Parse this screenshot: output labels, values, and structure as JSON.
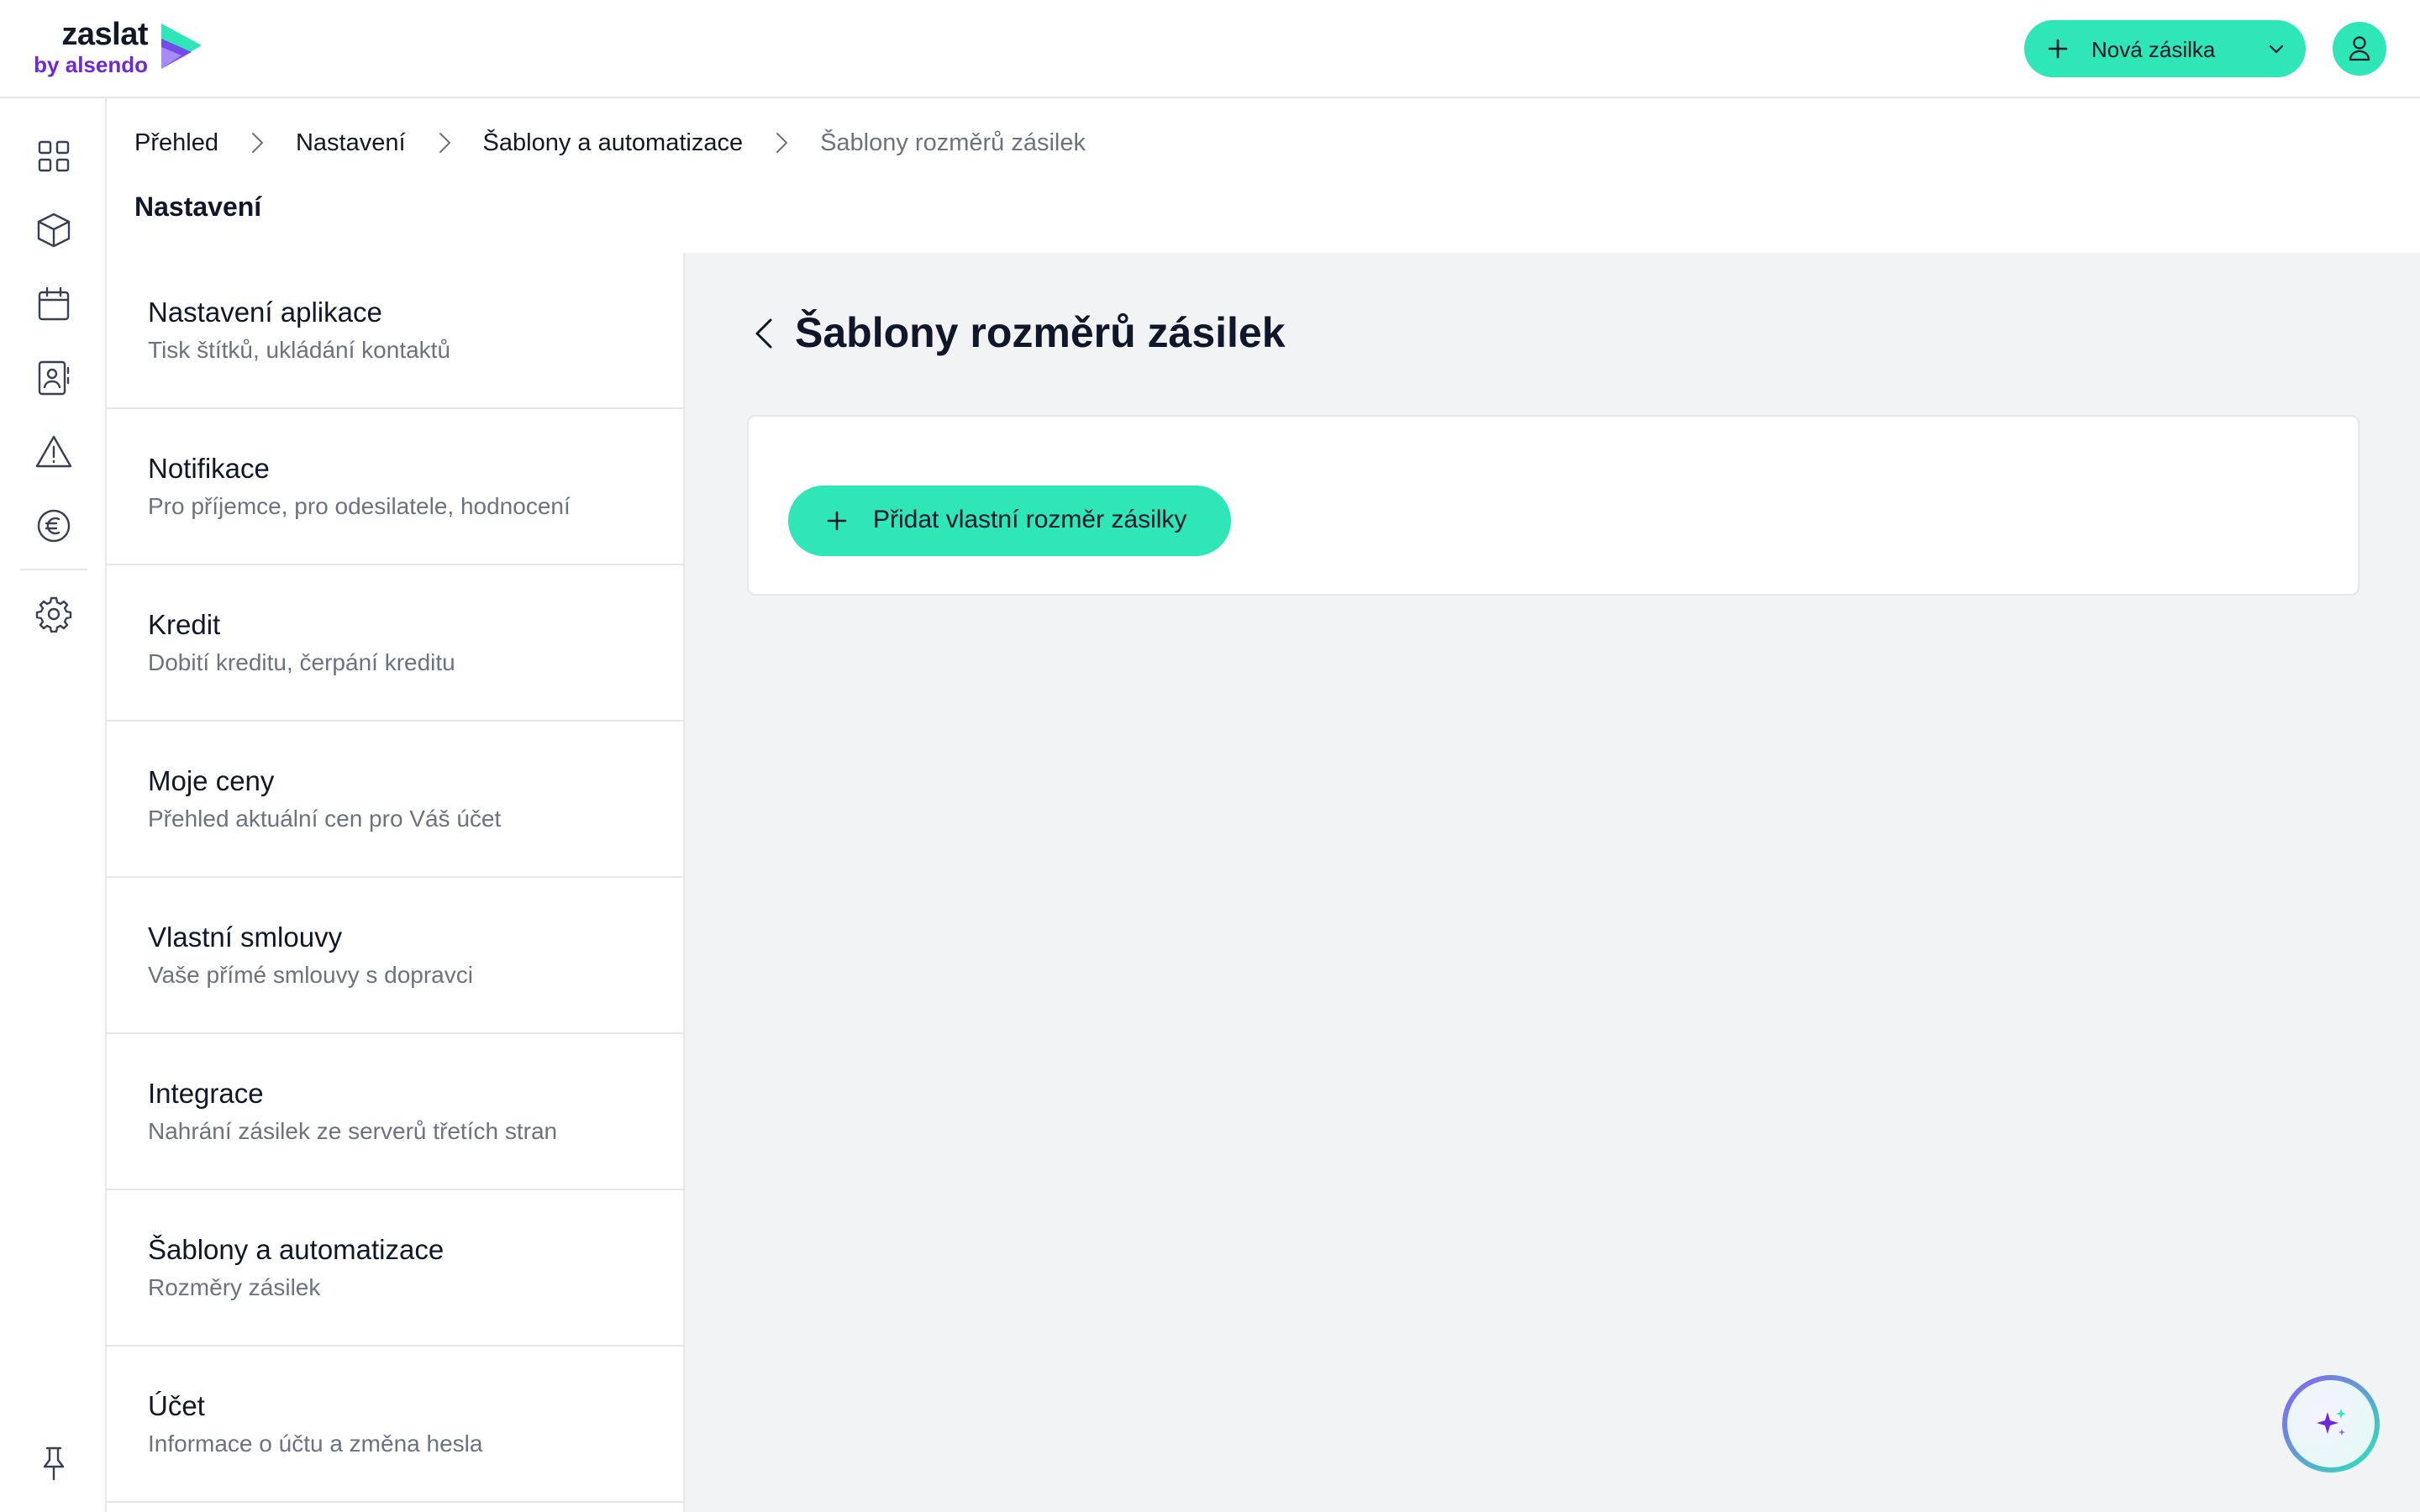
{
  "logo": {
    "main": "zaslat",
    "sub": "by alsendo"
  },
  "header": {
    "new_shipment_label": "Nová zásilka"
  },
  "breadcrumb": [
    "Přehled",
    "Nastavení",
    "Šablony a automatizace",
    "Šablony rozměrů zásilek"
  ],
  "page_heading": "Nastavení",
  "rail_icons": [
    "dashboard-icon",
    "package-icon",
    "calendar-icon",
    "contacts-icon",
    "warning-icon",
    "euro-icon",
    "gear-icon",
    "pin-icon"
  ],
  "settings": [
    {
      "title": "Nastavení aplikace",
      "desc": "Tisk štítků, ukládání kontaktů"
    },
    {
      "title": "Notifikace",
      "desc": "Pro příjemce, pro odesilatele, hodnocení"
    },
    {
      "title": "Kredit",
      "desc": "Dobití kreditu, čerpání kreditu"
    },
    {
      "title": "Moje ceny",
      "desc": "Přehled aktuální cen pro Váš účet"
    },
    {
      "title": "Vlastní smlouvy",
      "desc": "Vaše přímé smlouvy s dopravci"
    },
    {
      "title": "Integrace",
      "desc": "Nahrání zásilek ze serverů třetích stran"
    },
    {
      "title": "Šablony a automatizace",
      "desc": "Rozměry zásilek"
    },
    {
      "title": "Účet",
      "desc": "Informace o účtu a změna hesla"
    }
  ],
  "main": {
    "title": "Šablony rozměrů zásilek",
    "add_button_label": "Přidat vlastní rozměr zásilky"
  },
  "colors": {
    "accent": "#2ee6b6",
    "brand_purple": "#6d28d9",
    "panel_bg": "#f2f3f5"
  }
}
